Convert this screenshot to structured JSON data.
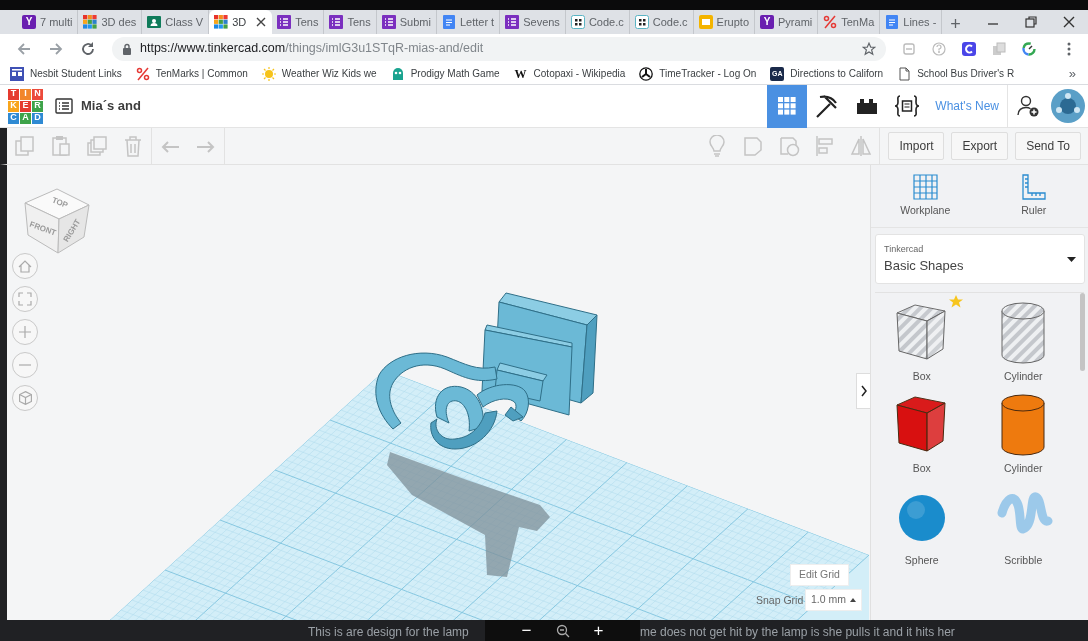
{
  "browser": {
    "tabs": [
      {
        "title": "7 multi",
        "icon_letter": "Y",
        "selected": false
      },
      {
        "title": "3D des",
        "selected": false
      },
      {
        "title": "Class V",
        "selected": false
      },
      {
        "title": "3D",
        "selected": true
      },
      {
        "title": "Tens",
        "selected": false
      },
      {
        "title": "Tens",
        "selected": false
      },
      {
        "title": "Submi",
        "selected": false
      },
      {
        "title": "Letter t",
        "selected": false
      },
      {
        "title": "Sevens",
        "selected": false
      },
      {
        "title": "Code.c",
        "selected": false
      },
      {
        "title": "Code.c",
        "selected": false
      },
      {
        "title": "Erupto",
        "selected": false
      },
      {
        "title": "Pyrami",
        "icon_letter": "Y",
        "selected": false
      },
      {
        "title": "TenMa",
        "selected": false
      },
      {
        "title": "Lines -",
        "selected": false
      }
    ],
    "new_tab": "+",
    "url_host": "https://www.tinkercad.com",
    "url_path": "/things/imlG3u1STqR-mias-and/edit",
    "bookmarks": [
      {
        "label": "Nesbit Student Links"
      },
      {
        "label": "TenMarks | Common"
      },
      {
        "label": "Weather Wiz Kids we"
      },
      {
        "label": "Prodigy Math Game"
      },
      {
        "label": "Cotopaxi - Wikipedia",
        "icon_letter": "W"
      },
      {
        "label": "TimeTracker - Log On"
      },
      {
        "label": "Directions to Californ",
        "icon_letter": "GA"
      },
      {
        "label": "School Bus Driver's R"
      }
    ],
    "more_bookmarks": "»"
  },
  "app": {
    "logo": [
      "T",
      "I",
      "N",
      "K",
      "E",
      "R",
      "C",
      "A",
      "D"
    ],
    "title": "Mia´s and",
    "views": [
      {
        "kind": "design",
        "selected": true
      },
      {
        "kind": "pickaxe",
        "selected": false
      },
      {
        "kind": "bricks",
        "selected": false
      },
      {
        "kind": "code",
        "selected": false
      }
    ],
    "whats_new": "What's New"
  },
  "toolbar": {
    "buttons": [
      "Import",
      "Export",
      "Send To"
    ]
  },
  "viewport": {
    "cube_faces": [
      "TOP",
      "FRONT",
      "RIGHT"
    ],
    "edit_grid": "Edit Grid",
    "snap_label": "Snap Grid",
    "snap_value": "1.0 mm"
  },
  "panel": {
    "tools": [
      {
        "kind": "workplane",
        "label": "Workplane"
      },
      {
        "kind": "ruler",
        "label": "Ruler"
      }
    ],
    "library_caption": "Tinkercad",
    "library": "Basic Shapes",
    "shapes": [
      {
        "kind": "box",
        "label": "Box",
        "hole": true,
        "favorite": true,
        "color": "#c4c7cc"
      },
      {
        "kind": "cylinder",
        "label": "Cylinder",
        "hole": true,
        "favorite": false,
        "color": "#c4c7cc"
      },
      {
        "kind": "box",
        "label": "Box",
        "hole": false,
        "favorite": false,
        "color": "#d81010"
      },
      {
        "kind": "cylinder",
        "label": "Cylinder",
        "hole": false,
        "favorite": false,
        "color": "#ee7a0e"
      },
      {
        "kind": "sphere",
        "label": "Sphere",
        "hole": false,
        "favorite": false,
        "color": "#1a8ccc"
      },
      {
        "kind": "scribble",
        "label": "Scribble",
        "hole": false,
        "favorite": false,
        "color": "#9cc9ea"
      }
    ]
  },
  "caption": {
    "before": "This is are design for the lamp",
    "after": "me does not get hit by the lamp is she pulls it and it hits her"
  },
  "zoom_bar": {
    "zoom_out": "−",
    "zoom_in": "+"
  }
}
